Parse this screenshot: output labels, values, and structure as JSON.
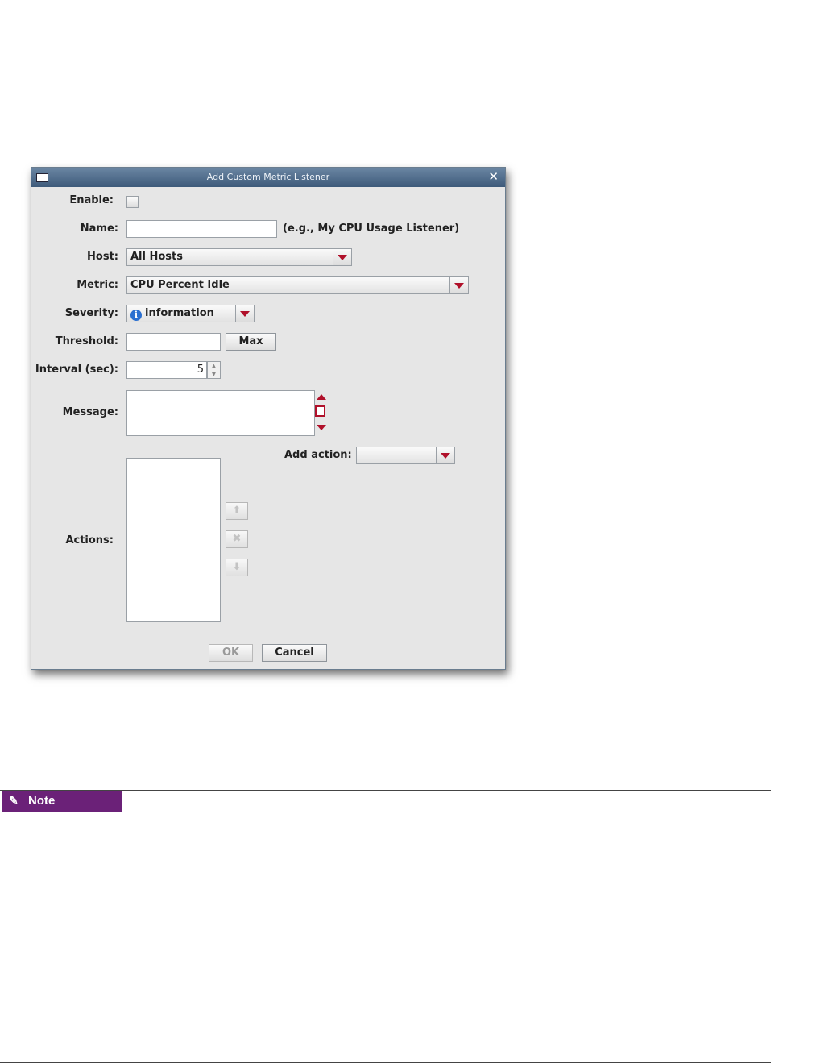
{
  "dialog": {
    "title": "Add Custom Metric Listener",
    "close": "✕",
    "enable_label": "Enable:",
    "name_label": "Name:",
    "name_value": "",
    "name_hint": "(e.g., My CPU Usage Listener)",
    "host_label": "Host:",
    "host_value": "All Hosts",
    "metric_label": "Metric:",
    "metric_value": "CPU Percent Idle",
    "severity_label": "Severity:",
    "severity_value": "information",
    "threshold_label": "Threshold:",
    "threshold_value": "",
    "max_button": "Max",
    "interval_label": "Interval (sec):",
    "interval_value": "5",
    "message_label": "Message:",
    "message_value": "",
    "add_action_label": "Add action:",
    "add_action_value": "",
    "actions_label": "Actions:",
    "ok_button": "OK",
    "cancel_button": "Cancel"
  },
  "note": {
    "label": "Note",
    "color": "#6b2178"
  }
}
